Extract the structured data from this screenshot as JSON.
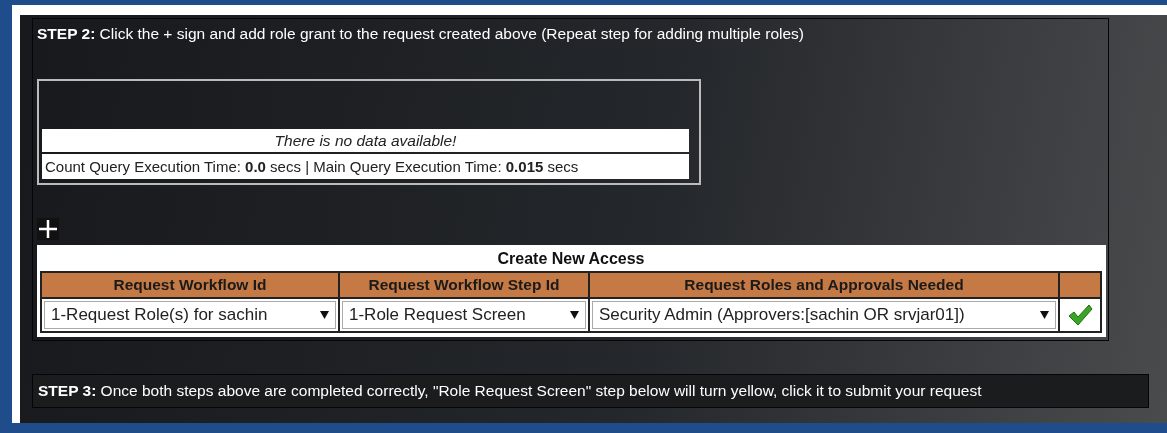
{
  "step2": {
    "text": "**STEP 2:** Click the + sign and add role grant to the request created above (Repeat step for adding multiple roles)"
  },
  "results": {
    "message": "There is no data available!",
    "timing": "Count Query Execution Time: **0.0** secs | Main Query Execution Time: **0.015** secs"
  },
  "create_access": {
    "title": "Create New Access",
    "columns": [
      "Request Workflow Id",
      "Request Workflow Step Id",
      "Request Roles and Approvals Needed"
    ],
    "row": [
      "1-Request Role(s) for sachin",
      "1-Role Request Screen",
      "Security Admin (Approvers:[sachin OR srvjar01])"
    ]
  },
  "step3": {
    "text": "**STEP 3:** Once both steps above are completed correctly, \"Role Request Screen\" step below will turn yellow, click it to submit your request"
  }
}
